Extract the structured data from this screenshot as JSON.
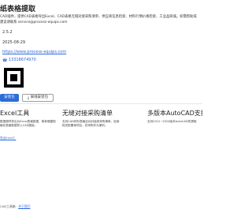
{
  "hero": {
    "title": "纸表格提取",
    "description": "CAD插件，提供CAD表格导出Excel、CAD表格无缝对接采购清单、供应商信息检索、材料行情价格检索、工业品商城。如需帮助或建议请联系 service@process-equips.com",
    "version": "2.5.2",
    "date": "2025-08-29",
    "website": "https://www.process-equips.com",
    "phone_icon": "phone-icon",
    "phone": "13318674970",
    "buttons": {
      "install": "安装包",
      "offline": "离线安装包"
    },
    "download_icon": "download-icon"
  },
  "features": [
    {
      "title": "Excel工具",
      "text": "数据源样导出为Excel表格数据，简单便捷规格化表格数据导入CAD图纸。",
      "link": "导出Excel？"
    },
    {
      "title": "无缝对接采购清单",
      "text": "支持CAD材料表格自动对接到采购清单，检索相关配置单项目，供采购作为便利。"
    },
    {
      "title": "多版本AutoCAD支持",
      "text": "支持2012~2024版本AutoCAD的提取"
    }
  ],
  "footer": {
    "prefix": "CAD工具箱 · ",
    "link": "关于我们"
  }
}
